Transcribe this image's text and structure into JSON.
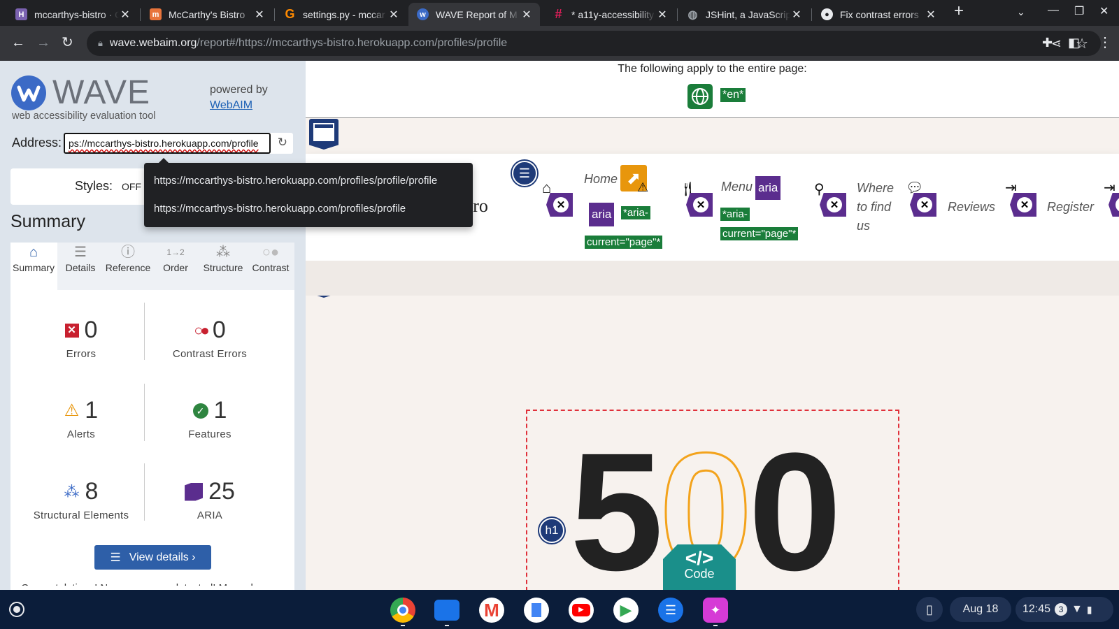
{
  "browser": {
    "tabs": [
      {
        "title": "mccarthys-bistro · C",
        "icon": "heroku-icon",
        "icon_color": "#7b62b0",
        "active": false
      },
      {
        "title": "McCarthy's Bistro",
        "icon": "mccarthys-icon",
        "icon_color": "#e8743b",
        "active": false
      },
      {
        "title": "settings.py - mccar",
        "icon": "gitpod-icon",
        "icon_color": "#ff8a00",
        "active": false
      },
      {
        "title": "WAVE Report of M",
        "icon": "wave-icon",
        "icon_color": "#3b6ac6",
        "active": true
      },
      {
        "title": "* a11y-accessibility",
        "icon": "slack-icon",
        "icon_color": "#e01e5a",
        "active": false
      },
      {
        "title": "JSHint, a JavaScrip",
        "icon": "globe-icon",
        "icon_color": "#9aa0a6",
        "active": false
      },
      {
        "title": "Fix contrast errors",
        "icon": "github-icon",
        "icon_color": "#e8eaed",
        "active": false
      }
    ],
    "url_domain": "wave.webaim.org",
    "url_path": "/report#/https://mccarthys-bistro.herokuapp.com/profiles/profile"
  },
  "wave": {
    "logo_text": "WAVE",
    "tagline": "web accessibility evaluation tool",
    "powered_by": "powered by",
    "webaim_link": "WebAIM",
    "address_label": "Address:",
    "address_value": "ps://mccarthys-bistro.herokuapp.com/profile",
    "styles_label": "Styles:",
    "styles_value": "OFF",
    "autocomplete": [
      "https://mccarthys-bistro.herokuapp.com/profiles/profile/profile",
      "https://mccarthys-bistro.herokuapp.com/profiles/profile"
    ],
    "summary_heading": "Summary",
    "nav_tabs": [
      {
        "label": "Summary",
        "icon": "home-icon"
      },
      {
        "label": "Details",
        "icon": "list-icon"
      },
      {
        "label": "Reference",
        "icon": "info-icon"
      },
      {
        "label": "Order",
        "icon": "order-icon"
      },
      {
        "label": "Structure",
        "icon": "structure-icon"
      },
      {
        "label": "Contrast",
        "icon": "contrast-icon"
      }
    ],
    "stats": {
      "errors": {
        "count": "0",
        "label": "Errors"
      },
      "contrast": {
        "count": "0",
        "label": "Contrast Errors"
      },
      "alerts": {
        "count": "1",
        "label": "Alerts"
      },
      "features": {
        "count": "1",
        "label": "Features"
      },
      "structural": {
        "count": "8",
        "label": "Structural Elements"
      },
      "aria": {
        "count": "25",
        "label": "ARIA"
      }
    },
    "view_details": "View details ›",
    "congrats_text": "Congratulations! No errors were detected! Manual"
  },
  "page": {
    "entire_page_text": "The following apply to the entire page:",
    "lang_label": "*en*",
    "brand_partial": "tro",
    "nav": {
      "home": "Home",
      "menu": "Menu",
      "where": "Where to find us",
      "reviews": "Reviews",
      "register": "Register"
    },
    "aria_badge": "aria",
    "aria_current_1": "*aria-current=\"page\"*",
    "aria_current_2": "*aria-current=\"page\"*",
    "h1_badge": "h1",
    "error_digits": [
      "5",
      "0",
      "0"
    ],
    "code_label": "Code"
  },
  "taskbar": {
    "date": "Aug 18",
    "time": "12:45",
    "notif_count": "3"
  }
}
